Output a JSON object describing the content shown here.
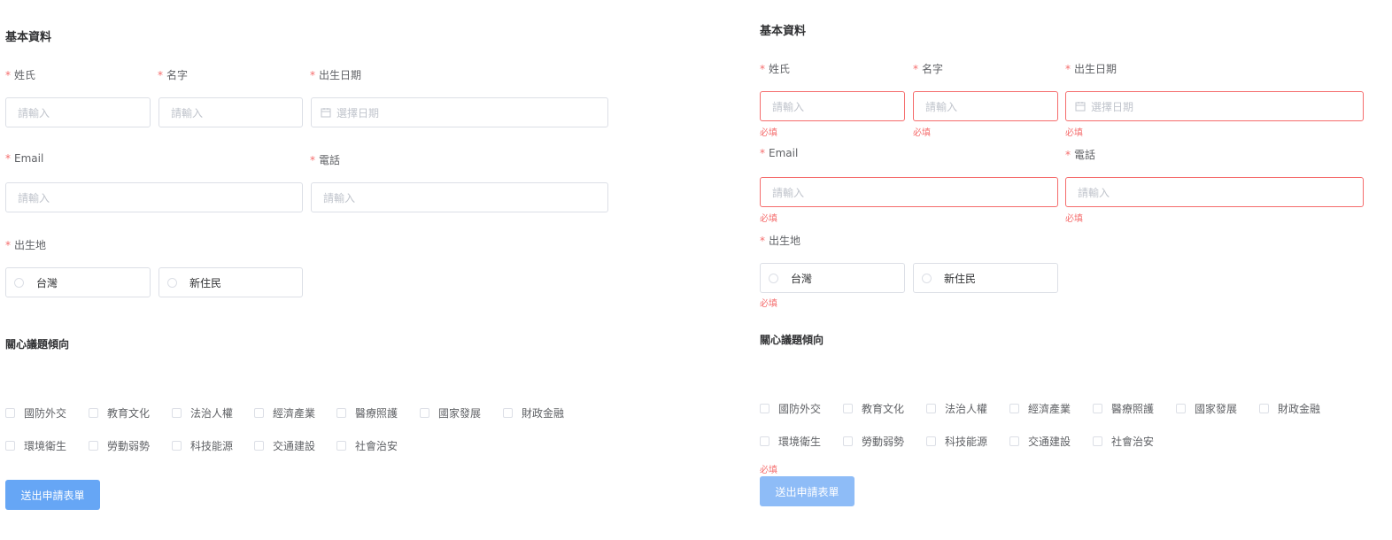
{
  "form": {
    "section_title": "基本資料",
    "required_mark": "*",
    "last_name_label": "姓氏",
    "first_name_label": "名字",
    "birthdate_label": "出生日期",
    "email_label": "Email",
    "phone_label": "電話",
    "birthplace_label": "出生地",
    "input_placeholder": "請輸入",
    "date_placeholder": "選擇日期",
    "birthplace_options": [
      "台灣",
      "新住民"
    ],
    "interest_title": "關心議題傾向",
    "interests": [
      "國防外交",
      "教育文化",
      "法治人權",
      "經濟產業",
      "醫療照護",
      "國家發展",
      "財政金融",
      "環境衛生",
      "勞動弱勢",
      "科技能源",
      "交通建設",
      "社會治安"
    ],
    "submit_label": "送出申請表單",
    "error_required": "必填"
  },
  "colors": {
    "error": "#f56c6c",
    "border": "#dcdfe6",
    "primary": "#66a6f5"
  }
}
